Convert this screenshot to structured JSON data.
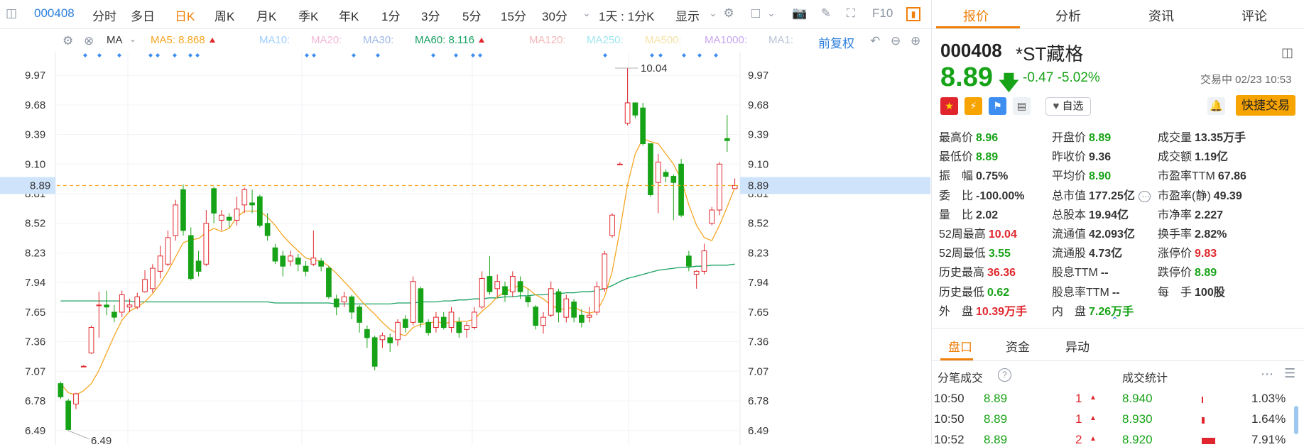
{
  "toolbar": {
    "code": "000408",
    "periods": [
      "分时",
      "多日",
      "日K",
      "周K",
      "月K",
      "季K",
      "年K",
      "1分",
      "3分",
      "5分",
      "15分",
      "30分"
    ],
    "active_period": "日K",
    "range_select": "1天 : 1分K",
    "display_select": "显示",
    "f10_label": "F10"
  },
  "ma_bar": {
    "ma_select": "MA",
    "ma5": "MA5: 8.868",
    "ma10": "MA10:",
    "ma20": "MA20:",
    "ma30": "MA30:",
    "ma60": "MA60: 8.116",
    "ma120": "MA120:",
    "ma250": "MA250:",
    "ma500": "MA500:",
    "ma1000": "MA1000:",
    "ma1": "MA1:",
    "adjust": "前复权",
    "colors": {
      "ma5": "#f5a623",
      "ma10": "#9ed0ff",
      "ma20": "#f4b6d8",
      "ma30": "#9fb8e8",
      "ma60": "#18a060",
      "ma120": "#f4b6b6",
      "ma250": "#9fe6f0",
      "ma500": "#f5e2a6",
      "ma1000": "#c9a6f0",
      "ma1": "#b8c4d4"
    }
  },
  "chart_data": {
    "type": "candlestick",
    "y_ticks": [
      "9.97",
      "9.68",
      "9.39",
      "9.10",
      "8.81",
      "8.52",
      "8.23",
      "7.94",
      "7.65",
      "7.36",
      "7.07",
      "6.78",
      "6.49"
    ],
    "current_price_label": "8.89",
    "high_label": "10.04",
    "low_label": "6.49",
    "ylim": [
      6.35,
      10.2
    ],
    "candles": [
      [
        6.95,
        6.82,
        6.97,
        6.8
      ],
      [
        6.78,
        6.5,
        6.8,
        6.49
      ],
      [
        6.75,
        6.85,
        6.86,
        6.7
      ],
      [
        7.12,
        7.12,
        7.13,
        7.12
      ],
      [
        7.25,
        7.5,
        7.52,
        7.24
      ],
      [
        7.72,
        7.72,
        7.85,
        7.4
      ],
      [
        7.72,
        7.7,
        7.86,
        7.62
      ],
      [
        7.65,
        7.6,
        7.72,
        7.55
      ],
      [
        7.65,
        7.82,
        7.86,
        7.6
      ],
      [
        7.7,
        7.72,
        7.78,
        7.65
      ],
      [
        7.7,
        7.8,
        7.84,
        7.68
      ],
      [
        7.85,
        7.97,
        8.06,
        7.84
      ],
      [
        7.88,
        8.08,
        8.12,
        7.84
      ],
      [
        8.05,
        8.2,
        8.3,
        7.98
      ],
      [
        8.12,
        8.38,
        8.45,
        8.1
      ],
      [
        8.4,
        8.7,
        8.75,
        8.35
      ],
      [
        8.85,
        8.45,
        8.9,
        8.4
      ],
      [
        8.4,
        7.98,
        8.48,
        7.96
      ],
      [
        8.15,
        8.05,
        8.25,
        8.0
      ],
      [
        8.12,
        8.52,
        8.65,
        8.1
      ],
      [
        8.86,
        8.62,
        8.88,
        8.52
      ],
      [
        8.55,
        8.6,
        8.65,
        8.45
      ],
      [
        8.58,
        8.55,
        8.62,
        8.48
      ],
      [
        8.55,
        8.66,
        8.78,
        8.5
      ],
      [
        8.7,
        8.85,
        8.87,
        8.62
      ],
      [
        8.72,
        8.7,
        8.85,
        8.62
      ],
      [
        8.78,
        8.5,
        8.8,
        8.48
      ],
      [
        8.52,
        8.4,
        8.62,
        8.35
      ],
      [
        8.28,
        8.15,
        8.32,
        8.12
      ],
      [
        8.2,
        8.1,
        8.25,
        8.0
      ],
      [
        8.15,
        8.2,
        8.25,
        8.1
      ],
      [
        8.18,
        8.12,
        8.22,
        8.05
      ],
      [
        8.1,
        8.05,
        8.15,
        8.0
      ],
      [
        8.12,
        8.18,
        8.45,
        8.1
      ],
      [
        8.15,
        8.1,
        8.18,
        8.05
      ],
      [
        8.08,
        7.8,
        8.1,
        7.78
      ],
      [
        7.78,
        7.7,
        7.82,
        7.62
      ],
      [
        7.75,
        7.8,
        7.85,
        7.7
      ],
      [
        7.8,
        7.65,
        7.82,
        7.58
      ],
      [
        7.7,
        7.55,
        7.72,
        7.45
      ],
      [
        7.48,
        7.4,
        7.52,
        7.3
      ],
      [
        7.4,
        7.12,
        7.42,
        7.08
      ],
      [
        7.38,
        7.42,
        7.45,
        7.3
      ],
      [
        7.4,
        7.35,
        7.44,
        7.26
      ],
      [
        7.38,
        7.55,
        7.58,
        7.32
      ],
      [
        7.58,
        7.5,
        7.62,
        7.45
      ],
      [
        7.55,
        7.95,
        8.0,
        7.52
      ],
      [
        7.88,
        7.55,
        7.9,
        7.5
      ],
      [
        7.55,
        7.45,
        7.58,
        7.42
      ],
      [
        7.5,
        7.6,
        7.65,
        7.45
      ],
      [
        7.6,
        7.5,
        7.65,
        7.48
      ],
      [
        7.5,
        7.65,
        7.7,
        7.45
      ],
      [
        7.55,
        7.45,
        7.6,
        7.4
      ],
      [
        7.48,
        7.52,
        7.55,
        7.4
      ],
      [
        7.5,
        7.65,
        7.7,
        7.48
      ],
      [
        7.7,
        7.98,
        8.05,
        7.68
      ],
      [
        8.0,
        7.85,
        8.2,
        7.82
      ],
      [
        7.88,
        7.95,
        8.02,
        7.8
      ],
      [
        7.9,
        7.82,
        7.95,
        7.75
      ],
      [
        7.85,
        8.0,
        8.05,
        7.8
      ],
      [
        7.95,
        7.85,
        8.0,
        7.78
      ],
      [
        7.8,
        7.75,
        7.88,
        7.7
      ],
      [
        7.7,
        7.52,
        7.72,
        7.48
      ],
      [
        7.52,
        7.6,
        7.65,
        7.44
      ],
      [
        7.62,
        7.88,
        7.95,
        7.6
      ],
      [
        7.85,
        7.65,
        7.88,
        7.55
      ],
      [
        7.6,
        7.78,
        7.82,
        7.55
      ],
      [
        7.75,
        7.6,
        7.78,
        7.55
      ],
      [
        7.62,
        7.55,
        7.68,
        7.5
      ],
      [
        7.6,
        7.62,
        7.7,
        7.55
      ],
      [
        7.65,
        7.9,
        7.95,
        7.62
      ],
      [
        7.88,
        8.22,
        8.25,
        7.85
      ],
      [
        8.4,
        8.6,
        8.62,
        8.38
      ],
      [
        9.1,
        9.1,
        9.12,
        9.1
      ],
      [
        9.5,
        9.7,
        10.04,
        9.48
      ],
      [
        9.7,
        9.58,
        9.7,
        9.55
      ],
      [
        9.65,
        9.3,
        9.7,
        9.28
      ],
      [
        9.3,
        8.8,
        9.3,
        8.78
      ],
      [
        8.92,
        9.12,
        9.2,
        8.62
      ],
      [
        9.02,
        8.98,
        9.05,
        8.92
      ],
      [
        8.98,
        8.92,
        9.0,
        8.55
      ],
      [
        9.1,
        8.6,
        9.15,
        8.58
      ],
      [
        8.2,
        8.1,
        8.25,
        8.05
      ],
      [
        8.02,
        8.05,
        8.06,
        7.88
      ],
      [
        8.05,
        8.25,
        8.32,
        8.02
      ],
      [
        8.52,
        8.65,
        8.68,
        8.5
      ],
      [
        8.65,
        9.1,
        9.12,
        8.6
      ],
      [
        9.35,
        9.33,
        9.58,
        9.22
      ],
      [
        8.86,
        8.89,
        8.96,
        8.86
      ]
    ],
    "ma5": [
      6.95,
      6.86,
      6.84,
      6.88,
      6.95,
      7.08,
      7.25,
      7.42,
      7.57,
      7.66,
      7.7,
      7.75,
      7.83,
      7.93,
      8.05,
      8.19,
      8.33,
      8.36,
      8.37,
      8.43,
      8.47,
      8.44,
      8.47,
      8.58,
      8.64,
      8.64,
      8.64,
      8.58,
      8.5,
      8.4,
      8.32,
      8.25,
      8.18,
      8.16,
      8.15,
      8.1,
      8.03,
      7.95,
      7.87,
      7.78,
      7.7,
      7.63,
      7.55,
      7.48,
      7.44,
      7.42,
      7.5,
      7.53,
      7.54,
      7.56,
      7.54,
      7.55,
      7.56,
      7.56,
      7.58,
      7.66,
      7.72,
      7.8,
      7.85,
      7.88,
      7.92,
      7.88,
      7.82,
      7.78,
      7.72,
      7.68,
      7.68,
      7.7,
      7.66,
      7.64,
      7.66,
      7.8,
      8.05,
      8.45,
      8.9,
      9.2,
      9.35,
      9.32,
      9.3,
      9.2,
      9.1,
      8.95,
      8.7,
      8.5,
      8.38,
      8.35,
      8.5,
      8.68,
      8.87
    ],
    "ma60": [
      7.76,
      7.76,
      7.76,
      7.76,
      7.76,
      7.76,
      7.76,
      7.76,
      7.76,
      7.76,
      7.75,
      7.75,
      7.75,
      7.75,
      7.75,
      7.75,
      7.75,
      7.75,
      7.75,
      7.75,
      7.75,
      7.75,
      7.75,
      7.75,
      7.75,
      7.75,
      7.75,
      7.75,
      7.74,
      7.74,
      7.74,
      7.74,
      7.74,
      7.74,
      7.74,
      7.74,
      7.73,
      7.73,
      7.73,
      7.73,
      7.73,
      7.73,
      7.73,
      7.73,
      7.74,
      7.74,
      7.74,
      7.75,
      7.75,
      7.75,
      7.76,
      7.76,
      7.77,
      7.77,
      7.78,
      7.78,
      7.79,
      7.79,
      7.8,
      7.8,
      7.81,
      7.81,
      7.82,
      7.82,
      7.83,
      7.83,
      7.84,
      7.84,
      7.85,
      7.85,
      7.86,
      7.88,
      7.91,
      7.95,
      7.98,
      8.0,
      8.02,
      8.04,
      8.06,
      8.07,
      8.08,
      8.09,
      8.09,
      8.1,
      8.1,
      8.11,
      8.11,
      8.11,
      8.12
    ]
  },
  "quote": {
    "tabs": [
      "报价",
      "分析",
      "资讯",
      "评论"
    ],
    "code": "000408",
    "name": "*ST藏格",
    "price": "8.89",
    "change": "-0.47",
    "change_pct": "-5.02%",
    "status": "交易中 02/23 10:53",
    "fav_label": "自选",
    "fast_trade": "快捷交易",
    "col1": [
      {
        "label": "最高价",
        "value": "8.96",
        "color": "g"
      },
      {
        "label": "最低价",
        "value": "8.89",
        "color": "g"
      },
      {
        "label": "振　幅",
        "value": "0.75%",
        "color": "k"
      },
      {
        "label": "委　比",
        "value": "-100.00%",
        "color": "k"
      },
      {
        "label": "量　比",
        "value": "2.02",
        "color": "k"
      },
      {
        "label": "52周最高",
        "value": "10.04",
        "color": "r"
      },
      {
        "label": "52周最低",
        "value": "3.55",
        "color": "g"
      },
      {
        "label": "历史最高",
        "value": "36.36",
        "color": "r"
      },
      {
        "label": "历史最低",
        "value": "0.62",
        "color": "g"
      },
      {
        "label": "外　盘",
        "value": "10.39万手",
        "color": "r"
      }
    ],
    "col2": [
      {
        "label": "开盘价",
        "value": "8.89",
        "color": "g"
      },
      {
        "label": "昨收价",
        "value": "9.36",
        "color": "k"
      },
      {
        "label": "平均价",
        "value": "8.90",
        "color": "g"
      },
      {
        "label": "总市值",
        "value": "177.25亿",
        "color": "k"
      },
      {
        "label": "总股本",
        "value": "19.94亿",
        "color": "k"
      },
      {
        "label": "流通值",
        "value": "42.093亿",
        "color": "k"
      },
      {
        "label": "流通股",
        "value": "4.73亿",
        "color": "k"
      },
      {
        "label": "股息TTM",
        "value": "--",
        "color": "k"
      },
      {
        "label": "股息率TTM",
        "value": "--",
        "color": "k"
      },
      {
        "label": "内　盘",
        "value": "7.26万手",
        "color": "g"
      }
    ],
    "col3": [
      {
        "label": "成交量",
        "value": "13.35万手",
        "color": "k"
      },
      {
        "label": "成交额",
        "value": "1.19亿",
        "color": "k"
      },
      {
        "label": "市盈率TTM",
        "value": "67.86",
        "color": "k"
      },
      {
        "label": "市盈率(静)",
        "value": "49.39",
        "color": "k"
      },
      {
        "label": "市净率",
        "value": "2.227",
        "color": "k"
      },
      {
        "label": "换手率",
        "value": "2.82%",
        "color": "k"
      },
      {
        "label": "涨停价",
        "value": "9.83",
        "color": "r"
      },
      {
        "label": "跌停价",
        "value": "8.89",
        "color": "g"
      },
      {
        "label": "每　手",
        "value": "100股",
        "color": "k"
      }
    ],
    "sub_tabs": [
      "盘口",
      "资金",
      "异动"
    ],
    "trades_title": "分笔成交",
    "stats_title": "成交统计",
    "trades": [
      {
        "time": "10:50",
        "price": "8.89",
        "vol": "1"
      },
      {
        "time": "10:50",
        "price": "8.89",
        "vol": "1"
      },
      {
        "time": "10:52",
        "price": "8.89",
        "vol": "2"
      }
    ],
    "stats": [
      {
        "price": "8.940",
        "pct": "1.03%"
      },
      {
        "price": "8.930",
        "pct": "1.64%"
      },
      {
        "price": "8.920",
        "pct": "7.91%"
      }
    ]
  }
}
